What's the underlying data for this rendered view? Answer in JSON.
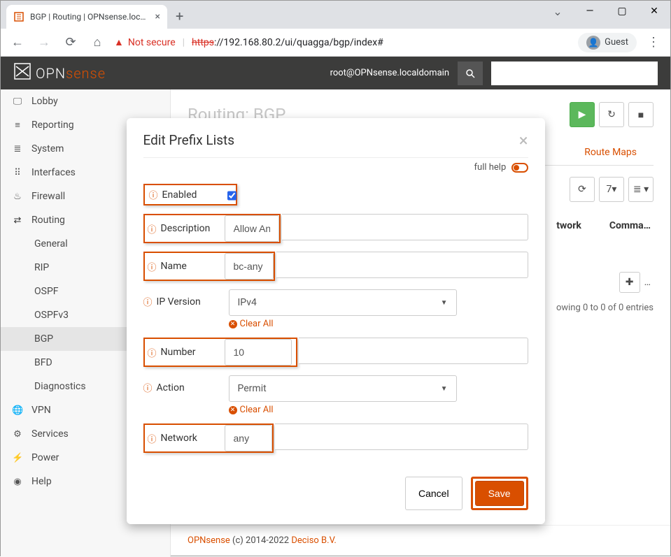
{
  "browser": {
    "tab_title": "BGP | Routing | OPNsense.locald",
    "new_tab": "+",
    "url_not_secure": "Not secure",
    "url_scheme": "https",
    "url_rest": "://192.168.80.2/ui/quagga/bgp/index#",
    "guest": "Guest"
  },
  "header": {
    "logo_white": "OPN",
    "logo_orange": "sense",
    "user": "root@OPNsense.localdomain"
  },
  "sidebar": {
    "items": [
      {
        "label": "Lobby",
        "icon": "▭"
      },
      {
        "label": "Reporting",
        "icon": "📊"
      },
      {
        "label": "System",
        "icon": "≣"
      },
      {
        "label": "Interfaces",
        "icon": "⁝⁝"
      },
      {
        "label": "Firewall",
        "icon": "🔥"
      },
      {
        "label": "Routing",
        "icon": "⇄",
        "expanded": true,
        "children": [
          {
            "label": "General"
          },
          {
            "label": "RIP"
          },
          {
            "label": "OSPF"
          },
          {
            "label": "OSPFv3"
          },
          {
            "label": "BGP",
            "active": true
          },
          {
            "label": "BFD"
          },
          {
            "label": "Diagnostics"
          }
        ]
      },
      {
        "label": "VPN",
        "icon": "🌐"
      },
      {
        "label": "Services",
        "icon": "⚙"
      },
      {
        "label": "Power",
        "icon": "🔌"
      },
      {
        "label": "Help",
        "icon": "◉"
      }
    ]
  },
  "page": {
    "title": "Routing: BGP",
    "tab_routemaps": "Route Maps",
    "col_network": "twork",
    "col_comma": "Comma…",
    "refresh_count": "7",
    "entries": "owing 0 to 0 of 0 entries",
    "add_more": "…"
  },
  "footer": {
    "brand": "OPNsense",
    "mid": " (c) 2014-2022 ",
    "company": "Deciso B.V."
  },
  "modal": {
    "title": "Edit Prefix Lists",
    "fullhelp": "full help",
    "fields": {
      "enabled": {
        "label": "Enabled",
        "checked": true
      },
      "description": {
        "label": "Description",
        "value": "Allow Any"
      },
      "name": {
        "label": "Name",
        "value": "bc-any"
      },
      "ipversion": {
        "label": "IP Version",
        "value": "IPv4",
        "clear": "Clear All"
      },
      "number": {
        "label": "Number",
        "value": "10"
      },
      "action": {
        "label": "Action",
        "value": "Permit",
        "clear": "Clear All"
      },
      "network": {
        "label": "Network",
        "value": "any"
      }
    },
    "cancel": "Cancel",
    "save": "Save"
  }
}
